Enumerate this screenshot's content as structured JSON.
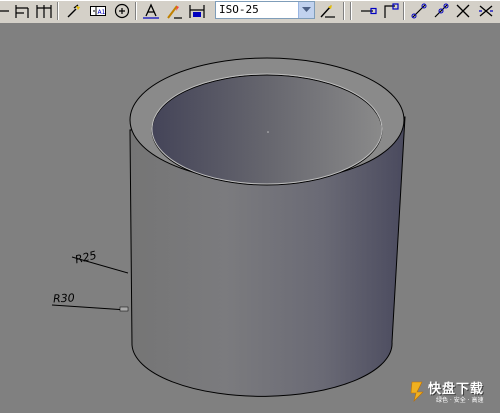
{
  "toolbar": {
    "dimstyle_combo": {
      "value": "ISO-25"
    },
    "left_buttons": [
      "dim-linear-icon",
      "dim-baseline-icon",
      "dim-continue-icon",
      "quick-leader-icon",
      "tolerance-icon",
      "center-mark-icon",
      "dim-edit-icon",
      "dim-text-edit-icon",
      "dim-update-icon"
    ],
    "right_buttons": [
      "dim-style-icon",
      "snap-endpoint-icon",
      "snap-node-icon",
      "snap-tangent-icon",
      "snap-perpendicular-icon",
      "snap-intersection-icon",
      "snap-none-icon"
    ]
  },
  "drawing": {
    "dimension_labels": [
      "R25",
      "R30"
    ],
    "model": "3d-cylinder-tube"
  },
  "watermark": {
    "title": "快盘下载",
    "subtitle": "绿色 · 安全 · 高速"
  }
}
